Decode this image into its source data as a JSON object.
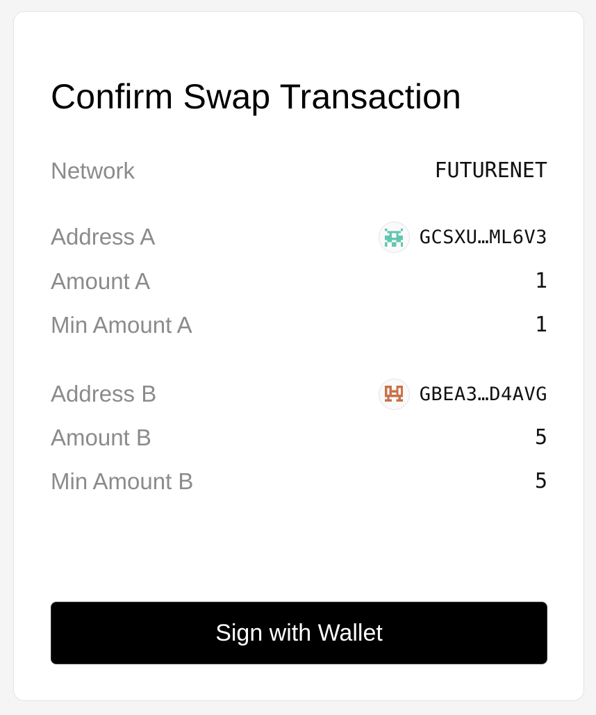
{
  "dialog": {
    "title": "Confirm Swap Transaction",
    "rows": [
      {
        "label": "Network",
        "value": "FUTURENET"
      },
      {
        "label": "Address A",
        "value": "GCSXU…ML6V3",
        "avatar_color": "#62c7b0",
        "avatar_icon": "identicon-teal"
      },
      {
        "label": "Amount A",
        "value": "1"
      },
      {
        "label": "Min Amount A",
        "value": "1"
      },
      {
        "label": "Address B",
        "value": "GBEA3…D4AVG",
        "avatar_color": "#c8714a",
        "avatar_icon": "identicon-orange"
      },
      {
        "label": "Amount B",
        "value": "5"
      },
      {
        "label": "Min Amount B",
        "value": "5"
      }
    ],
    "sign_button_label": "Sign with Wallet"
  }
}
